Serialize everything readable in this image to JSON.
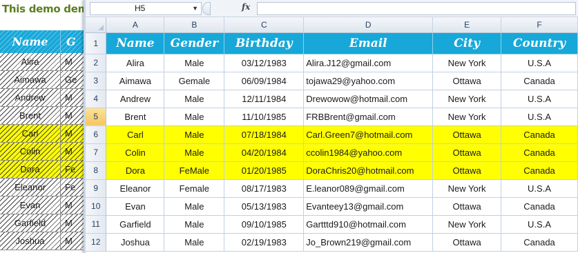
{
  "background_sheet": {
    "title": "This demo dem",
    "headers": [
      "Name",
      "G"
    ],
    "rows": [
      {
        "name": "Alira",
        "gender": "M",
        "highlight": false
      },
      {
        "name": "Aimawa",
        "gender": "Ge",
        "highlight": false
      },
      {
        "name": "Andrew",
        "gender": "M",
        "highlight": false
      },
      {
        "name": "Brent",
        "gender": "M",
        "highlight": false
      },
      {
        "name": "Carl",
        "gender": "M",
        "highlight": true
      },
      {
        "name": "Colin",
        "gender": "M",
        "highlight": true
      },
      {
        "name": "Dora",
        "gender": "Fe",
        "highlight": true
      },
      {
        "name": "Eleanor",
        "gender": "Fe",
        "highlight": false
      },
      {
        "name": "Evan",
        "gender": "M",
        "highlight": false
      },
      {
        "name": "Garfield",
        "gender": "M",
        "highlight": false
      },
      {
        "name": "Joshua",
        "gender": "M",
        "highlight": false
      }
    ]
  },
  "formula_bar": {
    "name_box": "H5",
    "fx_label": "fx",
    "formula": ""
  },
  "grid": {
    "columns": [
      "A",
      "B",
      "C",
      "D",
      "E",
      "F"
    ],
    "active_row": "5",
    "header_row": {
      "row_num": "1",
      "cells": [
        "Name",
        "Gender",
        "Birthday",
        "Email",
        "City",
        "Country"
      ]
    },
    "rows": [
      {
        "row_num": "2",
        "highlight": false,
        "cells": [
          "Alira",
          "Male",
          "03/12/1983",
          "Alira.J12@gmail.com",
          "New York",
          "U.S.A"
        ]
      },
      {
        "row_num": "3",
        "highlight": false,
        "cells": [
          "Aimawa",
          "Gemale",
          "06/09/1984",
          "tojawa29@yahoo.com",
          "Ottawa",
          "Canada"
        ]
      },
      {
        "row_num": "4",
        "highlight": false,
        "cells": [
          "Andrew",
          "Male",
          "12/11/1984",
          "Drewowow@hotmail.com",
          "New York",
          "U.S.A"
        ]
      },
      {
        "row_num": "5",
        "highlight": false,
        "cells": [
          "Brent",
          "Male",
          "11/10/1985",
          "FRBBrent@gmail.com",
          "New York",
          "U.S.A"
        ]
      },
      {
        "row_num": "6",
        "highlight": true,
        "cells": [
          "Carl",
          "Male",
          "07/18/1984",
          "Carl.Green7@hotmail.com",
          "Ottawa",
          "Canada"
        ]
      },
      {
        "row_num": "7",
        "highlight": true,
        "cells": [
          "Colin",
          "Male",
          "04/20/1984",
          "ccolin1984@yahoo.com",
          "Ottawa",
          "Canada"
        ]
      },
      {
        "row_num": "8",
        "highlight": true,
        "cells": [
          "Dora",
          "FeMale",
          "01/20/1985",
          "DoraChris20@hotmail.com",
          "Ottawa",
          "Canada"
        ]
      },
      {
        "row_num": "9",
        "highlight": false,
        "cells": [
          "Eleanor",
          "Female",
          "08/17/1983",
          "E.leanor089@gmail.com",
          "New York",
          "U.S.A"
        ]
      },
      {
        "row_num": "10",
        "highlight": false,
        "cells": [
          "Evan",
          "Male",
          "05/13/1983",
          "Evanteey13@gmail.com",
          "Ottawa",
          "Canada"
        ]
      },
      {
        "row_num": "11",
        "highlight": false,
        "cells": [
          "Garfield",
          "Male",
          "09/10/1985",
          "Gartttd910@hotmail.com",
          "New York",
          "U.S.A"
        ]
      },
      {
        "row_num": "12",
        "highlight": false,
        "cells": [
          "Joshua",
          "Male",
          "02/19/1983",
          "Jo_Brown219@gmail.com",
          "Ottawa",
          "Canada"
        ]
      }
    ]
  },
  "colors": {
    "header_fill": "#17a8d9",
    "highlight_fill": "#ffff00",
    "title_text": "#5a7f1f",
    "active_row_header": "#f5c55f"
  }
}
